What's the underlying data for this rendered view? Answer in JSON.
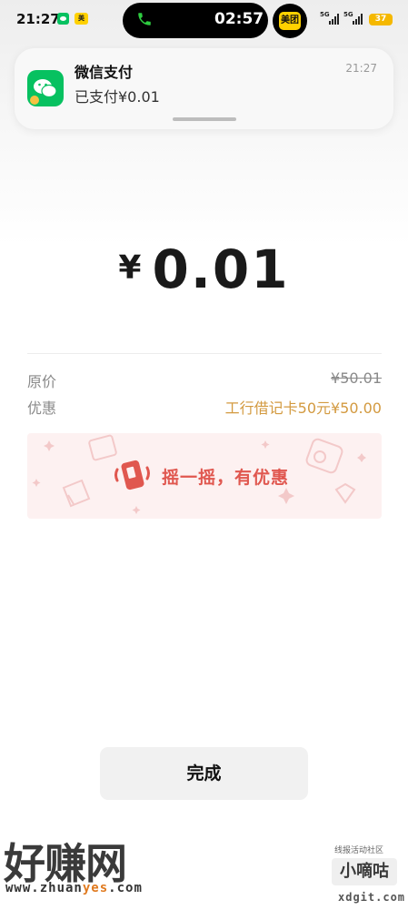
{
  "status_bar": {
    "time": "21:27",
    "call_timer": "02:57",
    "meituan_label": "美团",
    "signal_1": "5G",
    "signal_2": "5G",
    "battery": "37",
    "wechat_color": "#07c160",
    "meituan_color": "#ffd100"
  },
  "notification": {
    "app": "微信支付",
    "message": "已支付¥0.01",
    "time": "21:27"
  },
  "payment": {
    "currency": "¥",
    "amount": "0.01",
    "original_price_label": "原价",
    "original_price_value": "¥50.01",
    "discount_label": "优惠",
    "discount_value": "工行借记卡50元¥50.00"
  },
  "banner": {
    "text": "摇一摇，有优惠",
    "icon": "shake-phone-icon",
    "color": "#e0574f"
  },
  "actions": {
    "done_label": "完成"
  },
  "watermarks": {
    "site1_name": "好赚网",
    "site1_url_prefix": "www.zhuan",
    "site1_url_highlight": "yes",
    "site1_url_suffix": ".com",
    "site2_top": "线报活动社区",
    "site2_name": "小嘀咕",
    "site2_url": "xdgit.com"
  },
  "colors": {
    "accent_discount": "#d39a40",
    "button_bg": "#f1f1f1"
  }
}
